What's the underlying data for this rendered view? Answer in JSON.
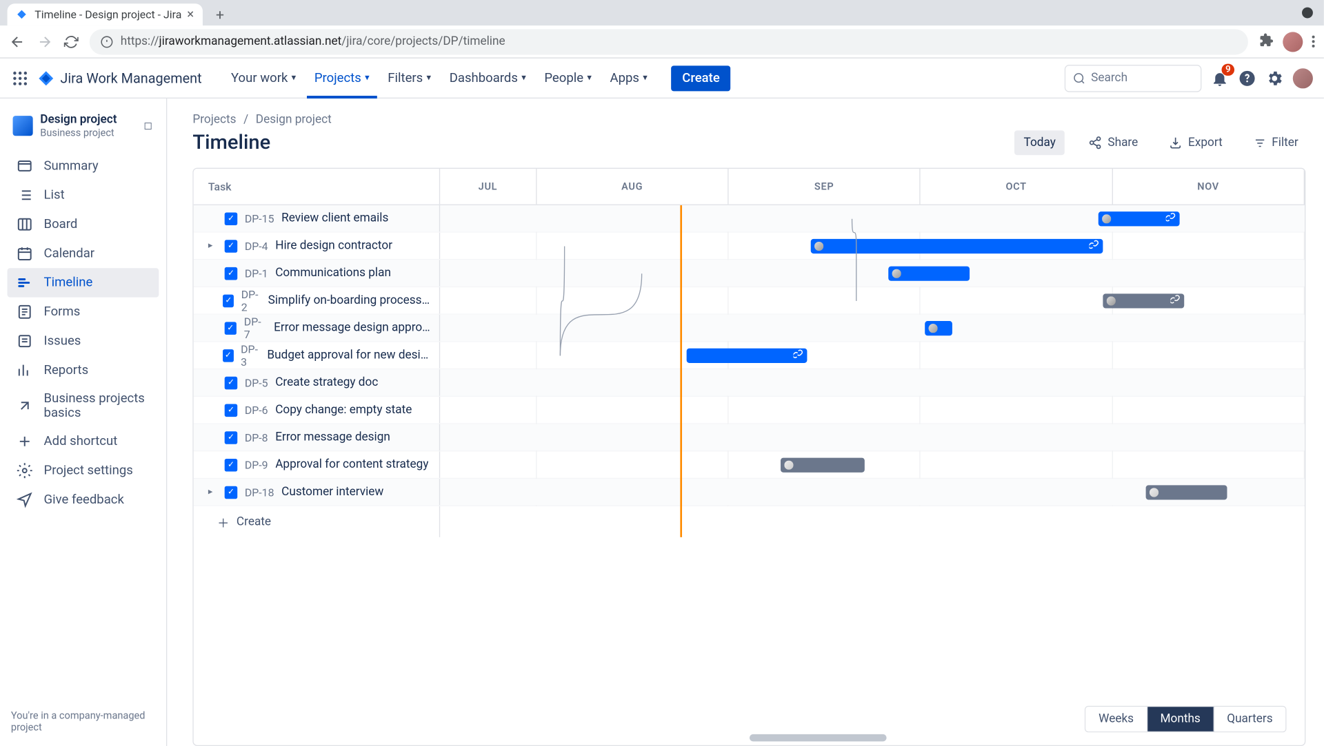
{
  "browser": {
    "tab_title": "Timeline - Design project - Jira",
    "url_prefix": "https://",
    "url_host": "jiraworkmanagement.atlassian.net",
    "url_path": "/jira/core/projects/DP/timeline"
  },
  "top_nav": {
    "product": "Jira Work Management",
    "items": [
      "Your work",
      "Projects",
      "Filters",
      "Dashboards",
      "People",
      "Apps"
    ],
    "active_index": 1,
    "create": "Create",
    "search_placeholder": "Search",
    "notification_count": "9"
  },
  "sidebar": {
    "project_name": "Design project",
    "project_type": "Business project",
    "items": [
      {
        "label": "Summary",
        "icon": "summary"
      },
      {
        "label": "List",
        "icon": "list"
      },
      {
        "label": "Board",
        "icon": "board"
      },
      {
        "label": "Calendar",
        "icon": "calendar"
      },
      {
        "label": "Timeline",
        "icon": "timeline",
        "active": true
      },
      {
        "label": "Forms",
        "icon": "forms"
      },
      {
        "label": "Issues",
        "icon": "issues"
      },
      {
        "label": "Reports",
        "icon": "reports"
      },
      {
        "label": "Business projects basics",
        "icon": "link"
      },
      {
        "label": "Add shortcut",
        "icon": "add"
      },
      {
        "label": "Project settings",
        "icon": "gear"
      },
      {
        "label": "Give feedback",
        "icon": "feedback"
      }
    ],
    "footer": "You're in a company-managed project"
  },
  "breadcrumb": [
    "Projects",
    "Design project"
  ],
  "page_title": "Timeline",
  "actions": {
    "today": "Today",
    "share": "Share",
    "export": "Export",
    "filter": "Filter"
  },
  "task_header": "Task",
  "months": [
    "JUL",
    "AUG",
    "SEP",
    "OCT",
    "NOV"
  ],
  "tasks": [
    {
      "key": "DP-15",
      "title": "Review client emails",
      "bar": {
        "start": 48,
        "width": 9.5,
        "color": "blue",
        "avatar": true,
        "link": true
      }
    },
    {
      "key": "DP-4",
      "title": "Hire design contractor",
      "expand": true,
      "bar": {
        "start": 14.5,
        "width": 34,
        "color": "blue",
        "avatar": true,
        "link": true
      }
    },
    {
      "key": "DP-1",
      "title": "Communications plan",
      "bar": {
        "start": 23.5,
        "width": 9.5,
        "color": "blue",
        "avatar": true
      }
    },
    {
      "key": "DP-2",
      "title": "Simplify on-boarding process for ne…",
      "bar": {
        "start": 48.5,
        "width": 9.5,
        "color": "gray",
        "avatar": true,
        "link": true
      }
    },
    {
      "key": "DP-7",
      "title": "Error message design approval",
      "bar": {
        "start": 27.8,
        "width": 3.2,
        "color": "blue",
        "avatar": true
      }
    },
    {
      "key": "DP-3",
      "title": "Budget approval for new design cont…",
      "bar": {
        "start": 0,
        "width": 14,
        "color": "blue",
        "link": true
      }
    },
    {
      "key": "DP-5",
      "title": "Create strategy doc"
    },
    {
      "key": "DP-6",
      "title": "Copy change: empty state"
    },
    {
      "key": "DP-8",
      "title": "Error message design"
    },
    {
      "key": "DP-9",
      "title": "Approval for content strategy",
      "bar": {
        "start": 11,
        "width": 9.7,
        "color": "gray",
        "avatar": true,
        "avatarStyle": "white"
      }
    },
    {
      "key": "DP-18",
      "title": "Customer interview",
      "expand": true,
      "bar": {
        "start": 53.5,
        "width": 9.5,
        "color": "gray",
        "avatar": true,
        "avatarStyle": "white"
      }
    }
  ],
  "create_label": "Create",
  "today_pos_pct": 28.0,
  "zoom": {
    "options": [
      "Weeks",
      "Months",
      "Quarters"
    ],
    "active": 1
  }
}
